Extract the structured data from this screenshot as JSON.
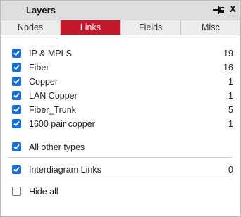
{
  "panel": {
    "title": "Layers",
    "pin_icon": "pin-icon",
    "close_label": "X"
  },
  "tabs": [
    {
      "label": "Nodes",
      "active": false
    },
    {
      "label": "Links",
      "active": true
    },
    {
      "label": "Fields",
      "active": false
    },
    {
      "label": "Misc",
      "active": false
    }
  ],
  "link_types": [
    {
      "label": "IP & MPLS",
      "count": "19",
      "checked": true
    },
    {
      "label": "Fiber",
      "count": "16",
      "checked": true
    },
    {
      "label": "Copper",
      "count": "1",
      "checked": true
    },
    {
      "label": "LAN Copper",
      "count": "1",
      "checked": true
    },
    {
      "label": "Fiber_Trunk",
      "count": "5",
      "checked": true
    },
    {
      "label": "1600 pair copper",
      "count": "1",
      "checked": true
    }
  ],
  "all_other_types": {
    "label": "All other types",
    "checked": true
  },
  "interdiagram": {
    "label": "Interdiagram Links",
    "count": "0",
    "checked": true
  },
  "hide_all": {
    "label": "Hide all",
    "checked": false
  },
  "colors": {
    "accent": "#c4172c",
    "checkbox": "#1a6fd6",
    "titlebar": "#dedede"
  }
}
